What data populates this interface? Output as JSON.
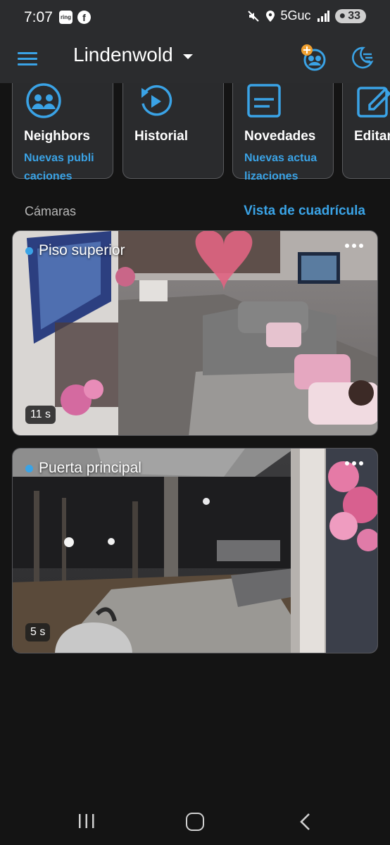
{
  "status_bar": {
    "time": "7:07",
    "ring_badge": "ring",
    "facebook_badge": "f",
    "network": "5Guc",
    "battery": "33"
  },
  "header": {
    "location": "Lindenwold"
  },
  "tiles": [
    {
      "title": "Neighbors",
      "subtitle": "Nuevas publi caciones",
      "icon": "neighbors-icon"
    },
    {
      "title": "Historial",
      "subtitle": "",
      "icon": "history-icon"
    },
    {
      "title": "Novedades",
      "subtitle": "Nuevas actua lizaciones",
      "icon": "news-icon"
    },
    {
      "title": "Editar",
      "subtitle": "",
      "icon": "edit-icon"
    }
  ],
  "cameras_section": {
    "title": "Cámaras",
    "grid_view": "Vista de cuadrícula"
  },
  "cameras": [
    {
      "name": "Piso superior",
      "age": "11 s"
    },
    {
      "name": "Puerta principal",
      "age": "5 s"
    }
  ],
  "colors": {
    "accent": "#3aa3e6",
    "header_bg": "#2b2c2e",
    "page_bg": "#141414"
  }
}
